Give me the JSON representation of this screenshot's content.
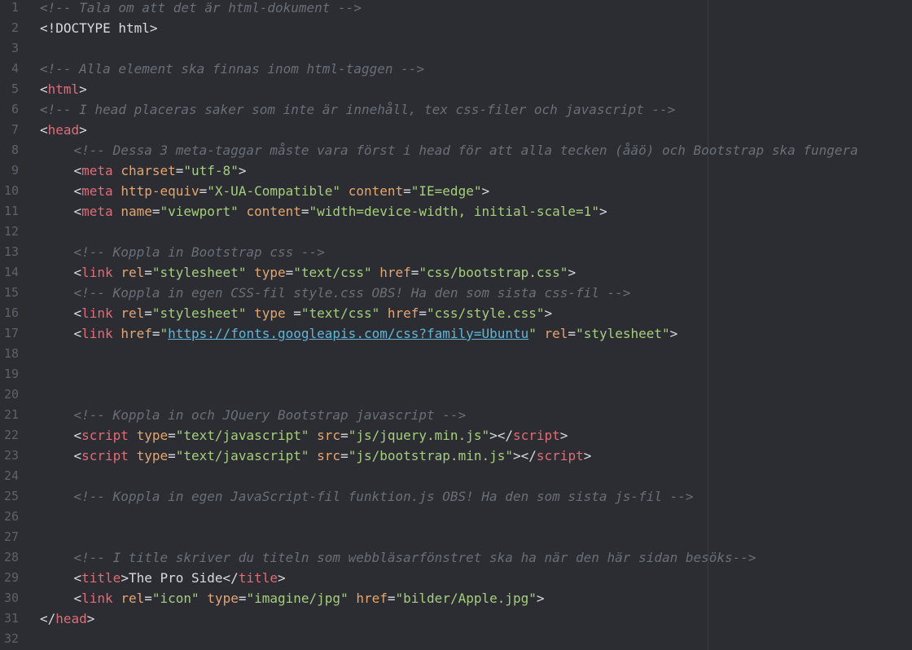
{
  "editor": {
    "lines": [
      {
        "n": "1",
        "indent": 0,
        "tokens": [
          {
            "t": "com",
            "v": "<!-- Tala om att det är html-dokument -->"
          }
        ]
      },
      {
        "n": "2",
        "indent": 0,
        "tokens": [
          {
            "t": "txt",
            "v": "<!DOCTYPE html>"
          }
        ]
      },
      {
        "n": "3",
        "indent": 0,
        "tokens": []
      },
      {
        "n": "4",
        "indent": 0,
        "tokens": [
          {
            "t": "com",
            "v": "<!-- Alla element ska finnas inom html-taggen -->"
          }
        ]
      },
      {
        "n": "5",
        "indent": 0,
        "tokens": [
          {
            "t": "pun",
            "v": "<"
          },
          {
            "t": "tag",
            "v": "html"
          },
          {
            "t": "pun",
            "v": ">"
          }
        ]
      },
      {
        "n": "6",
        "indent": 0,
        "tokens": [
          {
            "t": "com",
            "v": "<!-- I head placeras saker som inte är innehåll, tex css-filer och javascript -->"
          }
        ]
      },
      {
        "n": "7",
        "indent": 0,
        "tokens": [
          {
            "t": "pun",
            "v": "<"
          },
          {
            "t": "tag",
            "v": "head"
          },
          {
            "t": "pun",
            "v": ">"
          }
        ]
      },
      {
        "n": "8",
        "indent": 1,
        "tokens": [
          {
            "t": "com",
            "v": "<!-- Dessa 3 meta-taggar måste vara först i head för att alla tecken (åäö) och Bootstrap ska fungera"
          }
        ]
      },
      {
        "n": "9",
        "indent": 1,
        "tokens": [
          {
            "t": "pun",
            "v": "<"
          },
          {
            "t": "tag",
            "v": "meta"
          },
          {
            "t": "pun",
            "v": " "
          },
          {
            "t": "attr",
            "v": "charset"
          },
          {
            "t": "pun",
            "v": "="
          },
          {
            "t": "str",
            "v": "\"utf-8\""
          },
          {
            "t": "pun",
            "v": ">"
          }
        ]
      },
      {
        "n": "10",
        "indent": 1,
        "tokens": [
          {
            "t": "pun",
            "v": "<"
          },
          {
            "t": "tag",
            "v": "meta"
          },
          {
            "t": "pun",
            "v": " "
          },
          {
            "t": "attr",
            "v": "http-equiv"
          },
          {
            "t": "pun",
            "v": "="
          },
          {
            "t": "str",
            "v": "\"X-UA-Compatible\""
          },
          {
            "t": "pun",
            "v": " "
          },
          {
            "t": "attr",
            "v": "content"
          },
          {
            "t": "pun",
            "v": "="
          },
          {
            "t": "str",
            "v": "\"IE=edge\""
          },
          {
            "t": "pun",
            "v": ">"
          }
        ]
      },
      {
        "n": "11",
        "indent": 1,
        "tokens": [
          {
            "t": "pun",
            "v": "<"
          },
          {
            "t": "tag",
            "v": "meta"
          },
          {
            "t": "pun",
            "v": " "
          },
          {
            "t": "attr",
            "v": "name"
          },
          {
            "t": "pun",
            "v": "="
          },
          {
            "t": "str",
            "v": "\"viewport\""
          },
          {
            "t": "pun",
            "v": " "
          },
          {
            "t": "attr",
            "v": "content"
          },
          {
            "t": "pun",
            "v": "="
          },
          {
            "t": "str",
            "v": "\"width=device-width, initial-scale=1\""
          },
          {
            "t": "pun",
            "v": ">"
          }
        ]
      },
      {
        "n": "12",
        "indent": 0,
        "tokens": []
      },
      {
        "n": "13",
        "indent": 1,
        "tokens": [
          {
            "t": "com",
            "v": "<!-- Koppla in Bootstrap css -->"
          }
        ]
      },
      {
        "n": "14",
        "indent": 1,
        "tokens": [
          {
            "t": "pun",
            "v": "<"
          },
          {
            "t": "tag",
            "v": "link"
          },
          {
            "t": "pun",
            "v": " "
          },
          {
            "t": "attr",
            "v": "rel"
          },
          {
            "t": "pun",
            "v": "="
          },
          {
            "t": "str",
            "v": "\"stylesheet\""
          },
          {
            "t": "pun",
            "v": " "
          },
          {
            "t": "attr",
            "v": "type"
          },
          {
            "t": "pun",
            "v": "="
          },
          {
            "t": "str",
            "v": "\"text/css\""
          },
          {
            "t": "pun",
            "v": " "
          },
          {
            "t": "attr",
            "v": "href"
          },
          {
            "t": "pun",
            "v": "="
          },
          {
            "t": "str",
            "v": "\"css/bootstrap.css\""
          },
          {
            "t": "pun",
            "v": ">"
          }
        ]
      },
      {
        "n": "15",
        "indent": 1,
        "tokens": [
          {
            "t": "com",
            "v": "<!-- Koppla in egen CSS-fil style.css OBS! Ha den som sista css-fil -->"
          }
        ]
      },
      {
        "n": "16",
        "indent": 1,
        "tokens": [
          {
            "t": "pun",
            "v": "<"
          },
          {
            "t": "tag",
            "v": "link"
          },
          {
            "t": "pun",
            "v": " "
          },
          {
            "t": "attr",
            "v": "rel"
          },
          {
            "t": "pun",
            "v": "="
          },
          {
            "t": "str",
            "v": "\"stylesheet\""
          },
          {
            "t": "pun",
            "v": " "
          },
          {
            "t": "attr",
            "v": "type"
          },
          {
            "t": "pun",
            "v": " ="
          },
          {
            "t": "str",
            "v": "\"text/css\""
          },
          {
            "t": "pun",
            "v": " "
          },
          {
            "t": "attr",
            "v": "href"
          },
          {
            "t": "pun",
            "v": "="
          },
          {
            "t": "str",
            "v": "\"css/style.css\""
          },
          {
            "t": "pun",
            "v": ">"
          }
        ]
      },
      {
        "n": "17",
        "indent": 1,
        "tokens": [
          {
            "t": "pun",
            "v": "<"
          },
          {
            "t": "tag",
            "v": "link"
          },
          {
            "t": "pun",
            "v": " "
          },
          {
            "t": "attr",
            "v": "href"
          },
          {
            "t": "pun",
            "v": "="
          },
          {
            "t": "str",
            "v": "\""
          },
          {
            "t": "link",
            "v": "https://fonts.googleapis.com/css?family=Ubuntu"
          },
          {
            "t": "str",
            "v": "\""
          },
          {
            "t": "pun",
            "v": " "
          },
          {
            "t": "attr",
            "v": "rel"
          },
          {
            "t": "pun",
            "v": "="
          },
          {
            "t": "str",
            "v": "\"stylesheet\""
          },
          {
            "t": "pun",
            "v": ">"
          }
        ]
      },
      {
        "n": "18",
        "indent": 0,
        "tokens": []
      },
      {
        "n": "19",
        "indent": 0,
        "tokens": []
      },
      {
        "n": "20",
        "indent": 0,
        "tokens": []
      },
      {
        "n": "21",
        "indent": 1,
        "tokens": [
          {
            "t": "com",
            "v": "<!-- Koppla in och JQuery Bootstrap javascript -->"
          }
        ]
      },
      {
        "n": "22",
        "indent": 1,
        "tokens": [
          {
            "t": "pun",
            "v": "<"
          },
          {
            "t": "tag",
            "v": "script"
          },
          {
            "t": "pun",
            "v": " "
          },
          {
            "t": "attr",
            "v": "type"
          },
          {
            "t": "pun",
            "v": "="
          },
          {
            "t": "str",
            "v": "\"text/javascript\""
          },
          {
            "t": "pun",
            "v": " "
          },
          {
            "t": "attr",
            "v": "src"
          },
          {
            "t": "pun",
            "v": "="
          },
          {
            "t": "str",
            "v": "\"js/jquery.min.js\""
          },
          {
            "t": "pun",
            "v": "></"
          },
          {
            "t": "tag",
            "v": "script"
          },
          {
            "t": "pun",
            "v": ">"
          }
        ]
      },
      {
        "n": "23",
        "indent": 1,
        "tokens": [
          {
            "t": "pun",
            "v": "<"
          },
          {
            "t": "tag",
            "v": "script"
          },
          {
            "t": "pun",
            "v": " "
          },
          {
            "t": "attr",
            "v": "type"
          },
          {
            "t": "pun",
            "v": "="
          },
          {
            "t": "str",
            "v": "\"text/javascript\""
          },
          {
            "t": "pun",
            "v": " "
          },
          {
            "t": "attr",
            "v": "src"
          },
          {
            "t": "pun",
            "v": "="
          },
          {
            "t": "str",
            "v": "\"js/bootstrap.min.js\""
          },
          {
            "t": "pun",
            "v": "></"
          },
          {
            "t": "tag",
            "v": "script"
          },
          {
            "t": "pun",
            "v": ">"
          }
        ]
      },
      {
        "n": "24",
        "indent": 0,
        "tokens": []
      },
      {
        "n": "25",
        "indent": 1,
        "tokens": [
          {
            "t": "com",
            "v": "<!-- Koppla in egen JavaScript-fil funktion.js OBS! Ha den som sista js-fil -->"
          }
        ]
      },
      {
        "n": "26",
        "indent": 0,
        "tokens": []
      },
      {
        "n": "27",
        "indent": 0,
        "tokens": []
      },
      {
        "n": "28",
        "indent": 1,
        "tokens": [
          {
            "t": "com",
            "v": "<!-- I title skriver du titeln som webbläsarfönstret ska ha när den här sidan besöks-->"
          }
        ]
      },
      {
        "n": "29",
        "indent": 1,
        "tokens": [
          {
            "t": "pun",
            "v": "<"
          },
          {
            "t": "tag",
            "v": "title"
          },
          {
            "t": "pun",
            "v": ">"
          },
          {
            "t": "txt",
            "v": "The Pro Side"
          },
          {
            "t": "pun",
            "v": "</"
          },
          {
            "t": "tag",
            "v": "title"
          },
          {
            "t": "pun",
            "v": ">"
          }
        ]
      },
      {
        "n": "30",
        "indent": 1,
        "tokens": [
          {
            "t": "pun",
            "v": "<"
          },
          {
            "t": "tag",
            "v": "link"
          },
          {
            "t": "pun",
            "v": " "
          },
          {
            "t": "attr",
            "v": "rel"
          },
          {
            "t": "pun",
            "v": "="
          },
          {
            "t": "str",
            "v": "\"icon\""
          },
          {
            "t": "pun",
            "v": " "
          },
          {
            "t": "attr",
            "v": "type"
          },
          {
            "t": "pun",
            "v": "="
          },
          {
            "t": "str",
            "v": "\"imagine/jpg\""
          },
          {
            "t": "pun",
            "v": " "
          },
          {
            "t": "attr",
            "v": "href"
          },
          {
            "t": "pun",
            "v": "="
          },
          {
            "t": "str",
            "v": "\"bilder/Apple.jpg\""
          },
          {
            "t": "pun",
            "v": ">"
          }
        ]
      },
      {
        "n": "31",
        "indent": 0,
        "tokens": [
          {
            "t": "pun",
            "v": "</"
          },
          {
            "t": "tag",
            "v": "head"
          },
          {
            "t": "pun",
            "v": ">"
          }
        ]
      },
      {
        "n": "32",
        "indent": 0,
        "tokens": []
      }
    ]
  },
  "colors": {
    "background": "#2b2d33",
    "line_number": "#5d626b",
    "comment": "#6a6e76",
    "tag": "#e06c75",
    "attribute": "#e5a66e",
    "string": "#a5cf7a",
    "link": "#61b6d6",
    "text": "#d8dade"
  }
}
